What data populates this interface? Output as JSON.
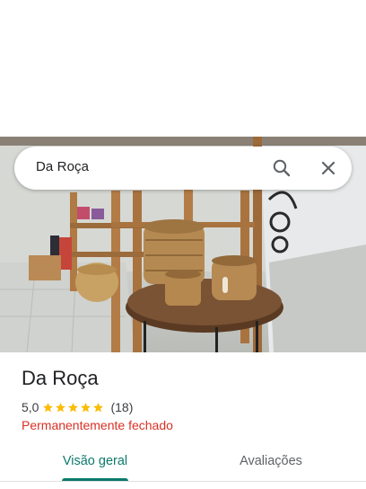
{
  "search": {
    "query": "Da Roça"
  },
  "place": {
    "name": "Da Roça",
    "rating": "5,0",
    "stars": 5,
    "review_count": "(18)",
    "status": "Permanentemente fechado"
  },
  "tabs": [
    {
      "label": "Visão geral",
      "selected": true
    },
    {
      "label": "Avaliações",
      "selected": false
    }
  ],
  "colors": {
    "accent": "#0b7a6b",
    "status_closed": "#d93025",
    "star": "#fbbc04"
  },
  "icons": [
    "search-icon",
    "close-icon",
    "star-icon"
  ]
}
